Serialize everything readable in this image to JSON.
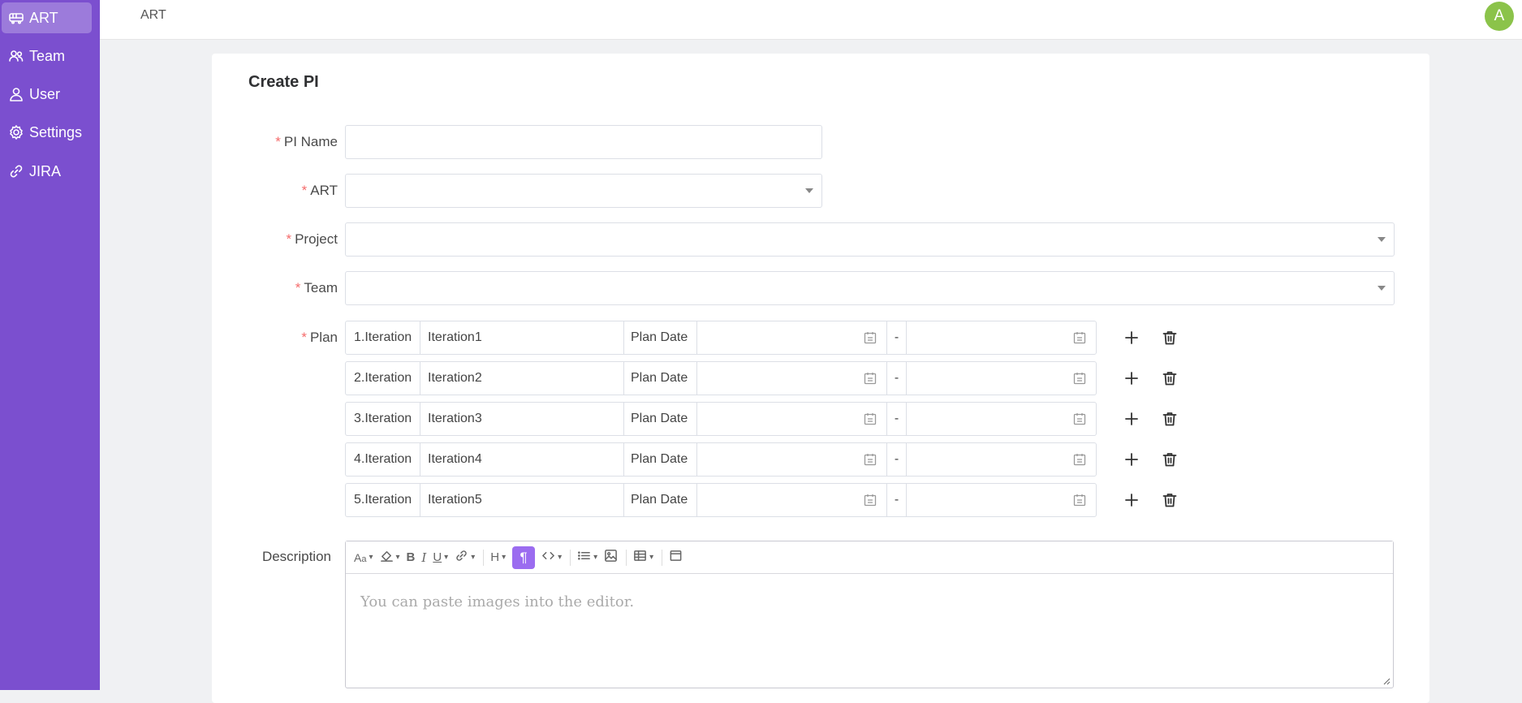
{
  "sidebar": {
    "items": [
      {
        "label": "ART",
        "icon": "train-icon",
        "active": true
      },
      {
        "label": "Team",
        "icon": "team-icon",
        "active": false
      },
      {
        "label": "User",
        "icon": "user-icon",
        "active": false
      },
      {
        "label": "Settings",
        "icon": "gear-icon",
        "active": false
      },
      {
        "label": "JIRA",
        "icon": "link-icon",
        "active": false
      }
    ]
  },
  "header": {
    "breadcrumb": "ART",
    "avatar_letter": "A"
  },
  "form": {
    "title": "Create PI",
    "pi_name": {
      "label": "PI Name",
      "value": ""
    },
    "art": {
      "label": "ART",
      "value": ""
    },
    "project": {
      "label": "Project",
      "value": ""
    },
    "team": {
      "label": "Team",
      "value": ""
    },
    "plan": {
      "label": "Plan",
      "rows": [
        {
          "index": "1.Iteration",
          "name": "Iteration1",
          "date_label": "Plan Date",
          "separator": "-"
        },
        {
          "index": "2.Iteration",
          "name": "Iteration2",
          "date_label": "Plan Date",
          "separator": "-"
        },
        {
          "index": "3.Iteration",
          "name": "Iteration3",
          "date_label": "Plan Date",
          "separator": "-"
        },
        {
          "index": "4.Iteration",
          "name": "Iteration4",
          "date_label": "Plan Date",
          "separator": "-"
        },
        {
          "index": "5.Iteration",
          "name": "Iteration5",
          "date_label": "Plan Date",
          "separator": "-"
        }
      ]
    },
    "description": {
      "label": "Description",
      "placeholder": "You can paste images into the editor."
    }
  },
  "colors": {
    "sidebar": "#7b4fcf",
    "accent": "#9b6cf0",
    "required": "#f56c6c",
    "avatar": "#8bc34a"
  }
}
